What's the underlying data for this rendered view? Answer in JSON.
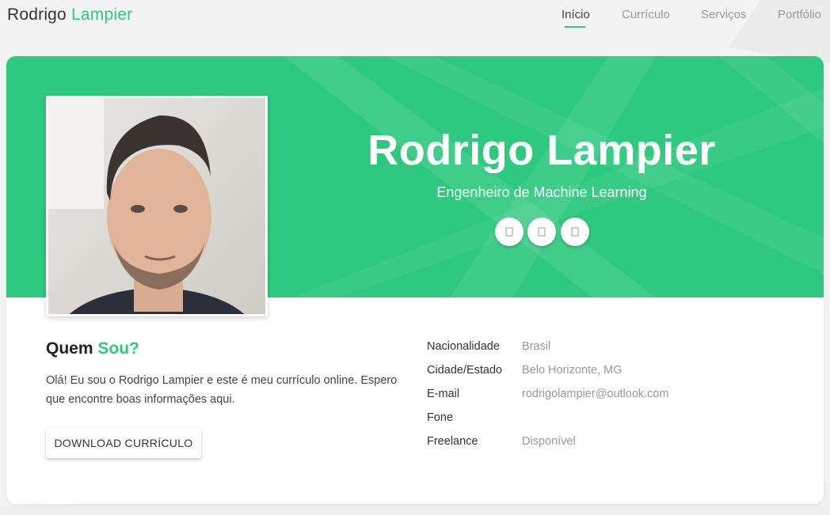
{
  "brand": {
    "first": "Rodrigo",
    "second": "Lampier"
  },
  "nav": {
    "items": [
      "Início",
      "Currículo",
      "Serviços",
      "Portfólio"
    ],
    "active": "Início"
  },
  "hero": {
    "name": "Rodrigo Lampier",
    "role": "Engenheiro de Machine Learning",
    "social_icons": [
      "social-icon-1",
      "social-icon-2",
      "social-icon-3"
    ]
  },
  "about": {
    "title_first": "Quem",
    "title_second": "Sou?",
    "text": "Olá! Eu sou o Rodrigo Lampier e este é meu currículo online. Espero que encontre boas informações aqui.",
    "download_label": "DOWNLOAD CURRÍCULO"
  },
  "info": [
    {
      "label": "Nacionalidade",
      "value": "Brasil"
    },
    {
      "label": "Cidade/Estado",
      "value": "Belo Horizonte, MG"
    },
    {
      "label": "E-mail",
      "value": "rodrigolampier@outlook.com"
    },
    {
      "label": "Fone",
      "value": ""
    },
    {
      "label": "Freelance",
      "value": "Disponível"
    }
  ],
  "colors": {
    "accent": "#2ec97e",
    "page_bg": "#f4f4f4",
    "text": "#333333",
    "muted": "#999999"
  }
}
